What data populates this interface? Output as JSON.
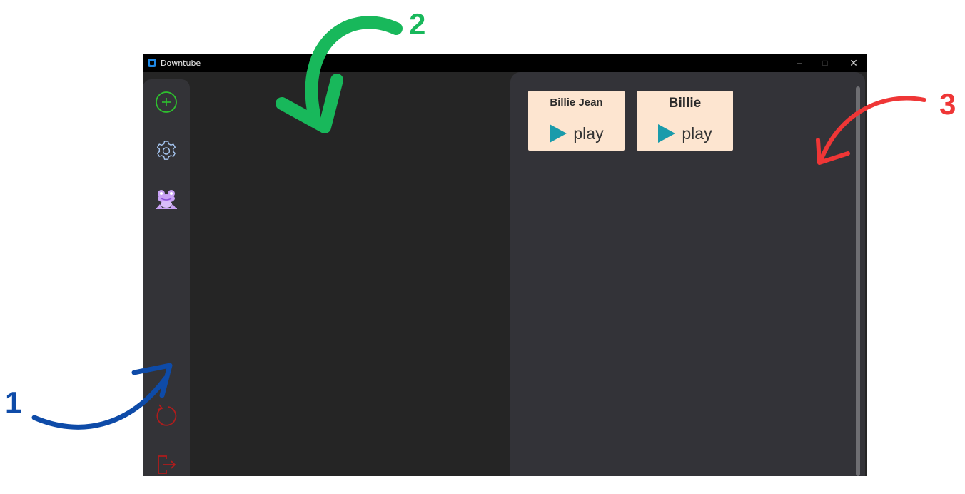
{
  "window": {
    "title": "Downtube",
    "controls": {
      "minimize": "–",
      "maximize": "□",
      "close": "✕"
    }
  },
  "sidebar": {
    "items": [
      {
        "name": "add",
        "icon": "plus-circle-icon",
        "color": "#2ec02e"
      },
      {
        "name": "settings",
        "icon": "gear-icon",
        "color": "#a7c7f2"
      },
      {
        "name": "frog",
        "icon": "frog-icon",
        "color": "#c9a2f5"
      },
      {
        "name": "refresh",
        "icon": "refresh-icon",
        "color": "#b01c1c"
      },
      {
        "name": "logout",
        "icon": "logout-icon",
        "color": "#b01c1c"
      }
    ]
  },
  "playlist": {
    "cards": [
      {
        "title": "Billie Jean",
        "play_label": "play"
      },
      {
        "title": "Billie",
        "play_label": "play"
      }
    ],
    "card_color": "#fde5d0",
    "play_icon_color": "#1a9bab"
  },
  "annotations": [
    {
      "label": "1",
      "color": "#0e4ba8"
    },
    {
      "label": "2",
      "color": "#18b85b"
    },
    {
      "label": "3",
      "color": "#ef3636"
    }
  ]
}
